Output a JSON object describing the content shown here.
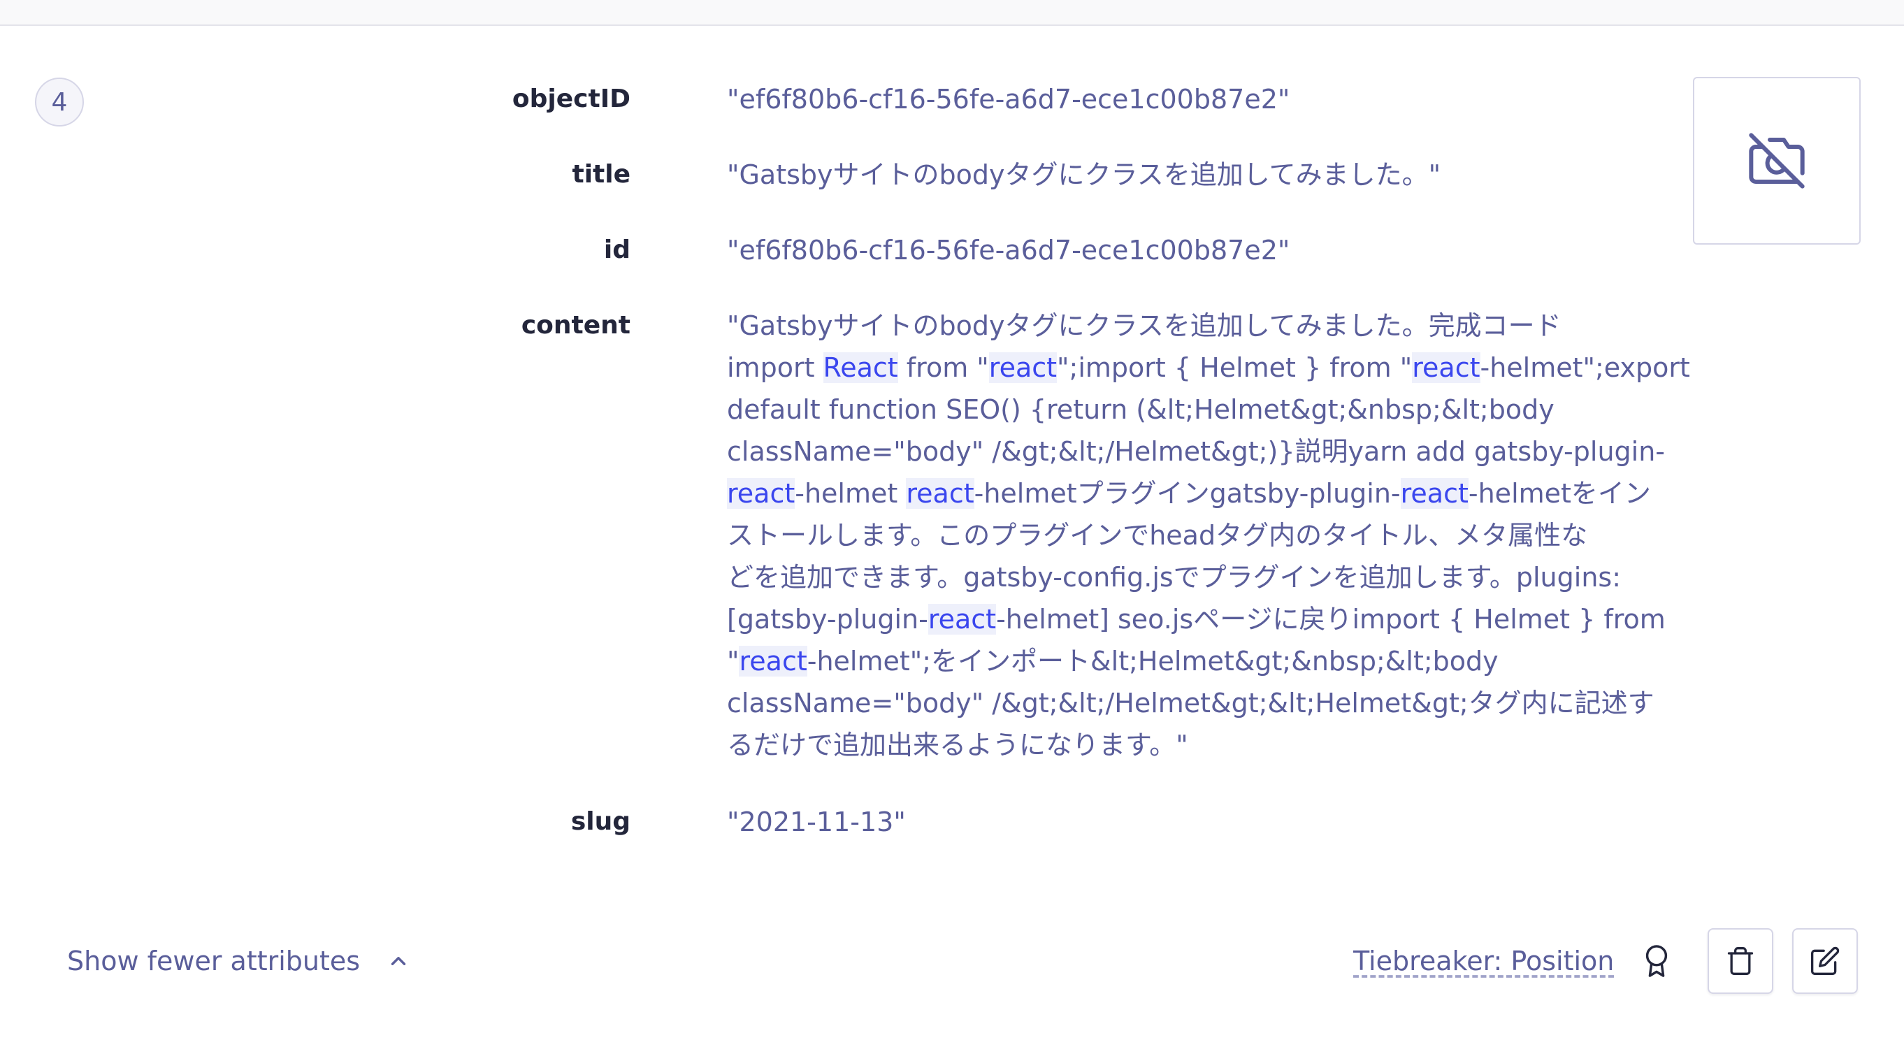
{
  "colors": {
    "label": "#23263b",
    "value": "#5a5e9a",
    "highlight_text": "#3a46ee",
    "highlight_bg": "#eef0fb",
    "border": "#d6d6e7"
  },
  "hit": {
    "position": "4",
    "attributes": [
      {
        "label": "objectID",
        "value": "\"ef6f80b6-cf16-56fe-a6d7-ece1c00b87e2\""
      },
      {
        "label": "title",
        "value": "\"Gatsbyサイトのbodyタグにクラスを追加してみました。\""
      },
      {
        "label": "id",
        "value": "\"ef6f80b6-cf16-56fe-a6d7-ece1c00b87e2\""
      }
    ],
    "content": {
      "label": "content",
      "highlight_term": "react",
      "lines": [
        [
          {
            "t": "\"Gatsbyサイトのbodyタグにクラスを追加してみました。完成コード"
          }
        ],
        [
          {
            "t": "import "
          },
          {
            "t": "React",
            "hl": true
          },
          {
            "t": " from \""
          },
          {
            "t": "react",
            "hl": true
          },
          {
            "t": "\";import { Helmet } from \""
          },
          {
            "t": "react",
            "hl": true
          },
          {
            "t": "-helmet\";export"
          }
        ],
        [
          {
            "t": "default function SEO() {return (&lt;Helmet&gt;&nbsp;&lt;body"
          }
        ],
        [
          {
            "t": "className=\"body\" /&gt;&lt;/Helmet&gt;)}説明yarn add gatsby-plugin-"
          }
        ],
        [
          {
            "t": "react",
            "hl": true
          },
          {
            "t": "-helmet "
          },
          {
            "t": "react",
            "hl": true
          },
          {
            "t": "-helmetプラグインgatsby-plugin-"
          },
          {
            "t": "react",
            "hl": true
          },
          {
            "t": "-helmetをイン"
          }
        ],
        [
          {
            "t": "ストールします。このプラグインでheadタグ内のタイトル、メタ属性な"
          }
        ],
        [
          {
            "t": "どを追加できます。gatsby-config.jsでプラグインを追加します。plugins:"
          }
        ],
        [
          {
            "t": "[gatsby-plugin-"
          },
          {
            "t": "react",
            "hl": true
          },
          {
            "t": "-helmet] seo.jsページに戻りimport { Helmet } from"
          }
        ],
        [
          {
            "t": "\""
          },
          {
            "t": "react",
            "hl": true
          },
          {
            "t": "-helmet\";をインポート&lt;Helmet&gt;&nbsp;&lt;body"
          }
        ],
        [
          {
            "t": "className=\"body\" /&gt;&lt;/Helmet&gt;&lt;Helmet&gt;タグ内に記述す"
          }
        ],
        [
          {
            "t": "るだけで追加出来るようになります。\""
          }
        ]
      ]
    },
    "slug": {
      "label": "slug",
      "value": "\"2021-11-13\""
    },
    "image_icon": "camera-off-icon"
  },
  "footer": {
    "toggle_label": "Show fewer attributes",
    "toggle_icon": "chevron-up-icon",
    "tiebreaker_label": "Tiebreaker: Position",
    "award_icon": "award-icon",
    "delete_icon": "trash-icon",
    "edit_icon": "edit-icon"
  }
}
